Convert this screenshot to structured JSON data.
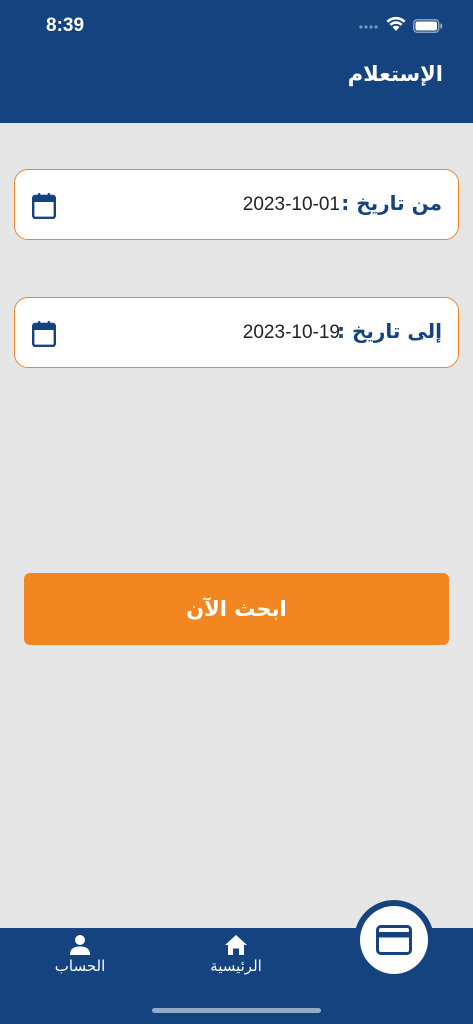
{
  "status_bar": {
    "time": "8:39"
  },
  "header": {
    "title": "الإستعلام"
  },
  "form": {
    "from_date": {
      "label": "من تاريخ :",
      "value": "2023-10-01"
    },
    "to_date": {
      "label": "إلى تاريخ :",
      "value": "2023-10-19"
    },
    "search_label": "ابحث الآن"
  },
  "bottom_nav": {
    "items": [
      {
        "label": "الحساب",
        "icon": "person-icon"
      },
      {
        "label": "الرئيسية",
        "icon": "home-icon"
      }
    ],
    "fab_icon": "credit-card-icon"
  },
  "colors": {
    "primary": "#14437f",
    "accent": "#f28722",
    "background": "#e6e6e6"
  }
}
